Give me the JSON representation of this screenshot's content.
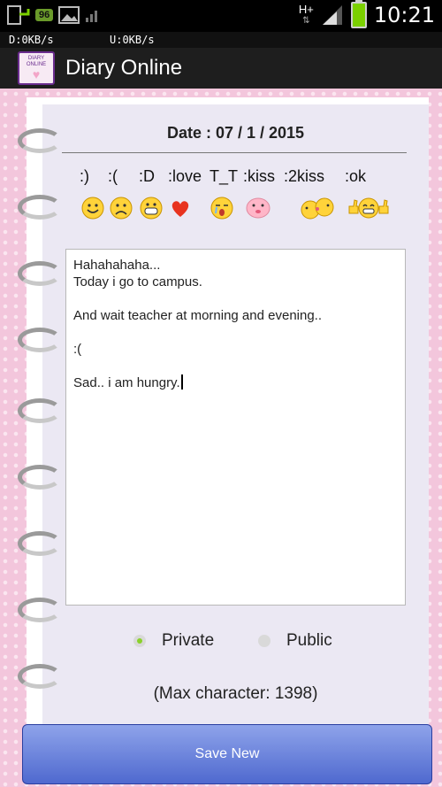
{
  "status_bar": {
    "time": "10:21",
    "network": "H+",
    "notification_count": "96",
    "icons": [
      "download-notification-icon",
      "bbm-notification-icon",
      "image-notification-icon",
      "signal-bars-icon",
      "battery-icon"
    ]
  },
  "net_speed": {
    "download": "D:0KB/s",
    "upload": "U:0KB/s"
  },
  "app": {
    "title": "Diary Online",
    "icon_text": "DIARY ONLINE"
  },
  "diary": {
    "date_label": "Date : 07 / 1 / 2015",
    "emoji_codes": [
      ":)",
      ":(",
      ":D",
      ":love",
      "T_T",
      ":kiss",
      ":2kiss",
      ":ok"
    ],
    "emoji_icons": [
      "smile-icon",
      "sad-icon",
      "grin-icon",
      "heart-icon",
      "crying-icon",
      "kiss-icon",
      "double-kiss-icon",
      "ok-thumbs-icon"
    ],
    "text_lines": [
      "Hahahahaha...",
      "Today i go to campus.",
      "And wait teacher at morning and evening..",
      ":(",
      "Sad.. i am hungry."
    ],
    "privacy": {
      "private_label": "Private",
      "public_label": "Public",
      "selected": "Private"
    },
    "max_char_label": "(Max character: 1398)",
    "save_label": "Save New"
  },
  "colors": {
    "accent_green": "#8ad12b",
    "button_blue": "#5a74d8",
    "app_bar": "#1e1e1e",
    "pink_background": "#f3c6dc"
  }
}
